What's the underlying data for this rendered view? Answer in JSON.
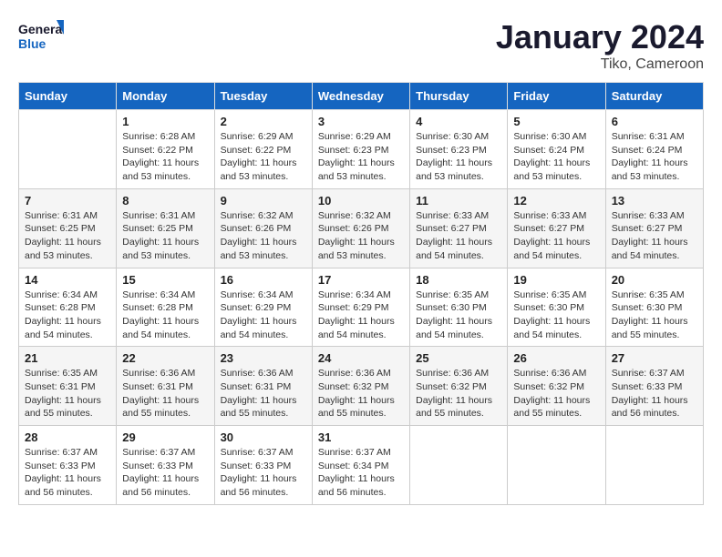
{
  "header": {
    "logo_line1": "General",
    "logo_line2": "Blue",
    "title": "January 2024",
    "subtitle": "Tiko, Cameroon"
  },
  "columns": [
    "Sunday",
    "Monday",
    "Tuesday",
    "Wednesday",
    "Thursday",
    "Friday",
    "Saturday"
  ],
  "weeks": [
    [
      {
        "day": "",
        "info": ""
      },
      {
        "day": "1",
        "info": "Sunrise: 6:28 AM\nSunset: 6:22 PM\nDaylight: 11 hours\nand 53 minutes."
      },
      {
        "day": "2",
        "info": "Sunrise: 6:29 AM\nSunset: 6:22 PM\nDaylight: 11 hours\nand 53 minutes."
      },
      {
        "day": "3",
        "info": "Sunrise: 6:29 AM\nSunset: 6:23 PM\nDaylight: 11 hours\nand 53 minutes."
      },
      {
        "day": "4",
        "info": "Sunrise: 6:30 AM\nSunset: 6:23 PM\nDaylight: 11 hours\nand 53 minutes."
      },
      {
        "day": "5",
        "info": "Sunrise: 6:30 AM\nSunset: 6:24 PM\nDaylight: 11 hours\nand 53 minutes."
      },
      {
        "day": "6",
        "info": "Sunrise: 6:31 AM\nSunset: 6:24 PM\nDaylight: 11 hours\nand 53 minutes."
      }
    ],
    [
      {
        "day": "7",
        "info": "Sunrise: 6:31 AM\nSunset: 6:25 PM\nDaylight: 11 hours\nand 53 minutes."
      },
      {
        "day": "8",
        "info": "Sunrise: 6:31 AM\nSunset: 6:25 PM\nDaylight: 11 hours\nand 53 minutes."
      },
      {
        "day": "9",
        "info": "Sunrise: 6:32 AM\nSunset: 6:26 PM\nDaylight: 11 hours\nand 53 minutes."
      },
      {
        "day": "10",
        "info": "Sunrise: 6:32 AM\nSunset: 6:26 PM\nDaylight: 11 hours\nand 53 minutes."
      },
      {
        "day": "11",
        "info": "Sunrise: 6:33 AM\nSunset: 6:27 PM\nDaylight: 11 hours\nand 54 minutes."
      },
      {
        "day": "12",
        "info": "Sunrise: 6:33 AM\nSunset: 6:27 PM\nDaylight: 11 hours\nand 54 minutes."
      },
      {
        "day": "13",
        "info": "Sunrise: 6:33 AM\nSunset: 6:27 PM\nDaylight: 11 hours\nand 54 minutes."
      }
    ],
    [
      {
        "day": "14",
        "info": "Sunrise: 6:34 AM\nSunset: 6:28 PM\nDaylight: 11 hours\nand 54 minutes."
      },
      {
        "day": "15",
        "info": "Sunrise: 6:34 AM\nSunset: 6:28 PM\nDaylight: 11 hours\nand 54 minutes."
      },
      {
        "day": "16",
        "info": "Sunrise: 6:34 AM\nSunset: 6:29 PM\nDaylight: 11 hours\nand 54 minutes."
      },
      {
        "day": "17",
        "info": "Sunrise: 6:34 AM\nSunset: 6:29 PM\nDaylight: 11 hours\nand 54 minutes."
      },
      {
        "day": "18",
        "info": "Sunrise: 6:35 AM\nSunset: 6:30 PM\nDaylight: 11 hours\nand 54 minutes."
      },
      {
        "day": "19",
        "info": "Sunrise: 6:35 AM\nSunset: 6:30 PM\nDaylight: 11 hours\nand 54 minutes."
      },
      {
        "day": "20",
        "info": "Sunrise: 6:35 AM\nSunset: 6:30 PM\nDaylight: 11 hours\nand 55 minutes."
      }
    ],
    [
      {
        "day": "21",
        "info": "Sunrise: 6:35 AM\nSunset: 6:31 PM\nDaylight: 11 hours\nand 55 minutes."
      },
      {
        "day": "22",
        "info": "Sunrise: 6:36 AM\nSunset: 6:31 PM\nDaylight: 11 hours\nand 55 minutes."
      },
      {
        "day": "23",
        "info": "Sunrise: 6:36 AM\nSunset: 6:31 PM\nDaylight: 11 hours\nand 55 minutes."
      },
      {
        "day": "24",
        "info": "Sunrise: 6:36 AM\nSunset: 6:32 PM\nDaylight: 11 hours\nand 55 minutes."
      },
      {
        "day": "25",
        "info": "Sunrise: 6:36 AM\nSunset: 6:32 PM\nDaylight: 11 hours\nand 55 minutes."
      },
      {
        "day": "26",
        "info": "Sunrise: 6:36 AM\nSunset: 6:32 PM\nDaylight: 11 hours\nand 55 minutes."
      },
      {
        "day": "27",
        "info": "Sunrise: 6:37 AM\nSunset: 6:33 PM\nDaylight: 11 hours\nand 56 minutes."
      }
    ],
    [
      {
        "day": "28",
        "info": "Sunrise: 6:37 AM\nSunset: 6:33 PM\nDaylight: 11 hours\nand 56 minutes."
      },
      {
        "day": "29",
        "info": "Sunrise: 6:37 AM\nSunset: 6:33 PM\nDaylight: 11 hours\nand 56 minutes."
      },
      {
        "day": "30",
        "info": "Sunrise: 6:37 AM\nSunset: 6:33 PM\nDaylight: 11 hours\nand 56 minutes."
      },
      {
        "day": "31",
        "info": "Sunrise: 6:37 AM\nSunset: 6:34 PM\nDaylight: 11 hours\nand 56 minutes."
      },
      {
        "day": "",
        "info": ""
      },
      {
        "day": "",
        "info": ""
      },
      {
        "day": "",
        "info": ""
      }
    ]
  ]
}
